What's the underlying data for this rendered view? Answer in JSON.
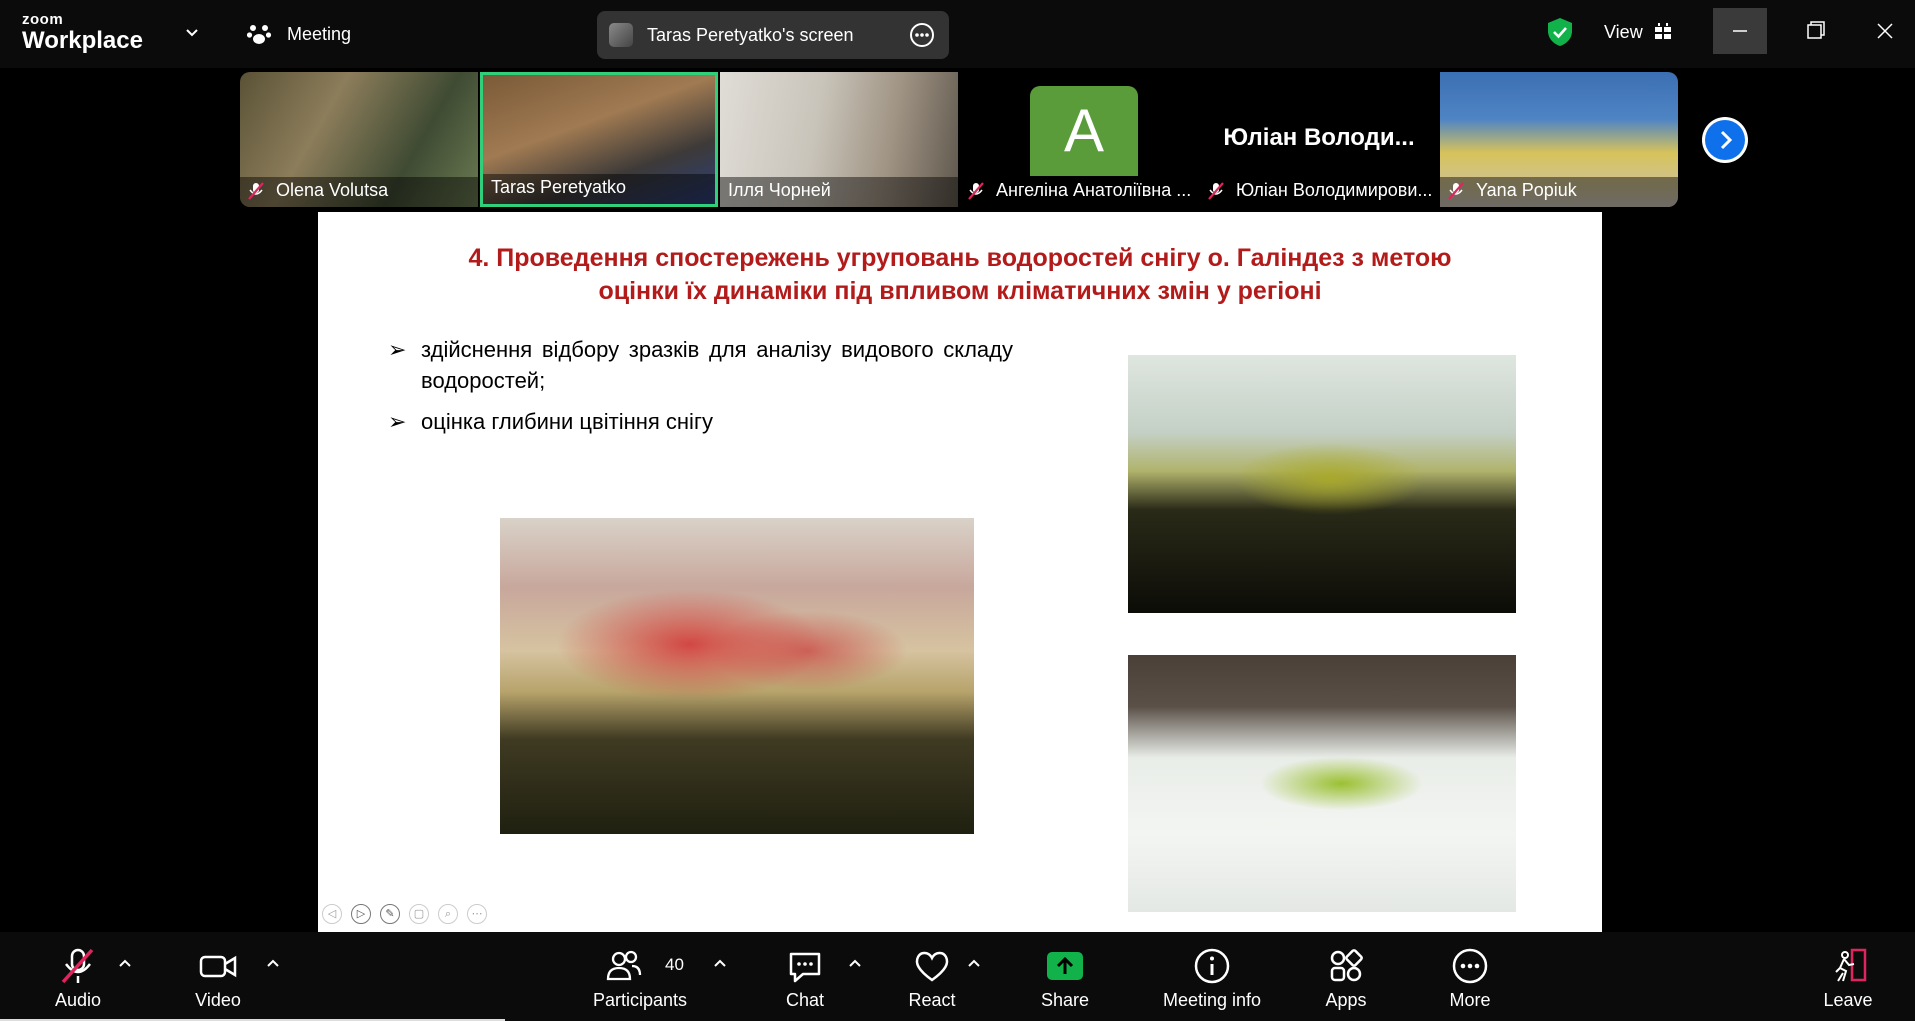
{
  "brand": {
    "small": "zoom",
    "big": "Workplace"
  },
  "meeting": {
    "label": "Meeting"
  },
  "share_pill": {
    "label": "Taras Peretyatko's screen"
  },
  "view": {
    "label": "View"
  },
  "participants_gallery": [
    {
      "name": "Olena Volutsa",
      "muted": true
    },
    {
      "name": "Taras Peretyatko",
      "muted": false,
      "active_speaker": true
    },
    {
      "name": "Ілля Чорней",
      "muted": false
    },
    {
      "name": "Ангеліна Анатоліївна ...",
      "muted": true,
      "avatar_letter": "A"
    },
    {
      "name": "Юліан Володимирови...",
      "muted": true,
      "display_name_big": "Юліан  Володи..."
    },
    {
      "name": "Yana Popiuk",
      "muted": true
    }
  ],
  "slide": {
    "title_line1": "4. Проведення спостережень угруповань водоростей снігу о. Галіндез з метою",
    "title_line2": "оцінки їх динаміки під впливом кліматичних змін у регіоні",
    "bullet_symbol": "➢",
    "bullets": [
      "здійснення відбору зразків для аналізу видового складу водоростей;",
      "оцінка глибини цвітіння снігу"
    ]
  },
  "toolbar": {
    "audio": "Audio",
    "video": "Video",
    "participants": "Participants",
    "participants_count": "40",
    "chat": "Chat",
    "react": "React",
    "share": "Share",
    "meeting_info": "Meeting info",
    "apps": "Apps",
    "more": "More",
    "leave": "Leave"
  },
  "colors": {
    "accent_green": "#30d07a",
    "share_green": "#12b24a",
    "title_red": "#b31b1b",
    "zoom_blue": "#0e71eb",
    "mute_red": "#e0245e"
  }
}
